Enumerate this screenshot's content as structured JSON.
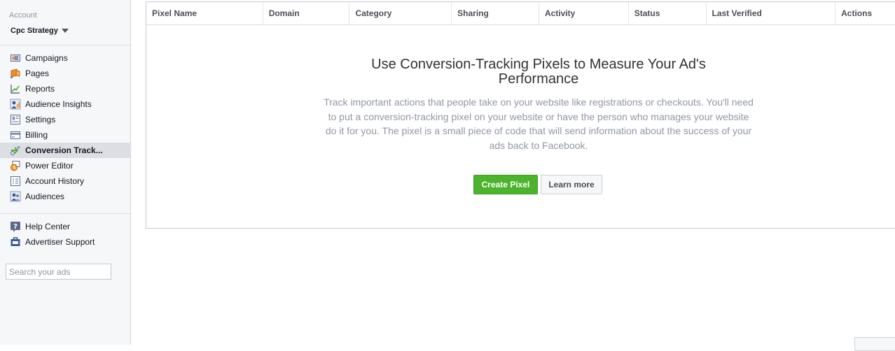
{
  "account": {
    "label": "Account",
    "name": "Cpc Strategy"
  },
  "nav_primary": [
    {
      "label": "Campaigns",
      "icon": "campaigns-icon"
    },
    {
      "label": "Pages",
      "icon": "pages-icon"
    },
    {
      "label": "Reports",
      "icon": "reports-icon"
    },
    {
      "label": "Audience Insights",
      "icon": "audience-insights-icon"
    },
    {
      "label": "Settings",
      "icon": "settings-icon"
    },
    {
      "label": "Billing",
      "icon": "billing-icon"
    },
    {
      "label": "Conversion Track...",
      "icon": "conversion-tracking-icon",
      "selected": true
    },
    {
      "label": "Power Editor",
      "icon": "power-editor-icon"
    },
    {
      "label": "Account History",
      "icon": "account-history-icon"
    },
    {
      "label": "Audiences",
      "icon": "audiences-icon"
    }
  ],
  "nav_help": [
    {
      "label": "Help Center",
      "icon": "help-center-icon"
    },
    {
      "label": "Advertiser Support",
      "icon": "advertiser-support-icon"
    }
  ],
  "search": {
    "placeholder": "Search your ads",
    "value": ""
  },
  "table": {
    "columns": [
      "Pixel Name",
      "Domain",
      "Category",
      "Sharing",
      "Activity",
      "Status",
      "Last Verified",
      "Actions"
    ]
  },
  "empty_state": {
    "title_line1": "Use Conversion-Tracking Pixels to Measure Your Ad's",
    "title_line2": "Performance",
    "description": "Track important actions that people take on your website like registrations or checkouts. You'll need to put a conversion-tracking pixel on your website or have the person who manages your website do it for you. The pixel is a small piece of code that will send information about the success of your ads back to Facebook.",
    "create_label": "Create Pixel",
    "learn_label": "Learn more"
  },
  "colors": {
    "primary_button": "#4cb32d",
    "selected_nav": "#dcdee3",
    "sidebar_bg": "#f6f7f8"
  }
}
